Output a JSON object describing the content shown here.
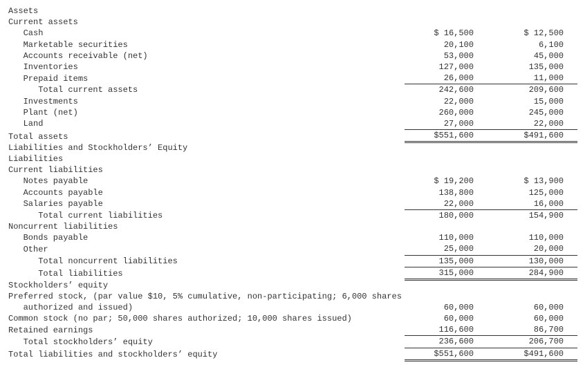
{
  "rows": [
    {
      "label": "Assets",
      "a": "",
      "b": "",
      "cls": ""
    },
    {
      "label": "Current assets",
      "a": "",
      "b": "",
      "cls": ""
    },
    {
      "label": "   Cash",
      "a": "$ 16,500",
      "b": "$ 12,500",
      "cls": ""
    },
    {
      "label": "   Marketable securities",
      "a": "20,100",
      "b": "6,100",
      "cls": ""
    },
    {
      "label": "   Accounts receivable (net)",
      "a": "53,000",
      "b": "45,000",
      "cls": ""
    },
    {
      "label": "   Inventories",
      "a": "127,000",
      "b": "135,000",
      "cls": ""
    },
    {
      "label": "   Prepaid items",
      "a": "26,000",
      "b": "11,000",
      "cls": "single"
    },
    {
      "label": "      Total current assets",
      "a": "242,600",
      "b": "209,600",
      "cls": ""
    },
    {
      "label": "   Investments",
      "a": "22,000",
      "b": "15,000",
      "cls": ""
    },
    {
      "label": "   Plant (net)",
      "a": "260,000",
      "b": "245,000",
      "cls": ""
    },
    {
      "label": "   Land",
      "a": "27,000",
      "b": "22,000",
      "cls": "single"
    },
    {
      "label": "Total assets",
      "a": "$551,600",
      "b": "$491,600",
      "cls": "dbl"
    },
    {
      "label": "Liabilities and Stockholders’ Equity",
      "a": "",
      "b": "",
      "cls": ""
    },
    {
      "label": "Liabilities",
      "a": "",
      "b": "",
      "cls": ""
    },
    {
      "label": "Current liabilities",
      "a": "",
      "b": "",
      "cls": ""
    },
    {
      "label": "   Notes payable",
      "a": "$ 19,200",
      "b": "$ 13,900",
      "cls": ""
    },
    {
      "label": "   Accounts payable",
      "a": "138,800",
      "b": "125,000",
      "cls": ""
    },
    {
      "label": "   Salaries payable",
      "a": "22,000",
      "b": "16,000",
      "cls": "single"
    },
    {
      "label": "      Total current liabilities",
      "a": "180,000",
      "b": "154,900",
      "cls": "subtotal"
    },
    {
      "label": "Noncurrent liabilities",
      "a": "",
      "b": "",
      "cls": ""
    },
    {
      "label": "   Bonds payable",
      "a": "110,000",
      "b": "110,000",
      "cls": ""
    },
    {
      "label": "   Other",
      "a": "25,000",
      "b": "20,000",
      "cls": "single"
    },
    {
      "label": "      Total noncurrent liabilities",
      "a": "135,000",
      "b": "130,000",
      "cls": "subtotal"
    },
    {
      "label": "      Total liabilities",
      "a": "315,000",
      "b": "284,900",
      "cls": "dbl"
    },
    {
      "label": "Stockholders’ equity",
      "a": "",
      "b": "",
      "cls": ""
    },
    {
      "label": "Preferred stock, (par value $10, 5% cumulative, non-participating; 6,000 shares\n   authorized and issued)",
      "a": "60,000",
      "b": "60,000",
      "cls": ""
    },
    {
      "label": "Common stock (no par; 50,000 shares authorized; 10,000 shares issued)",
      "a": "60,000",
      "b": "60,000",
      "cls": ""
    },
    {
      "label": "Retained earnings",
      "a": "116,600",
      "b": "86,700",
      "cls": "single"
    },
    {
      "label": "   Total stockholders’ equity",
      "a": "236,600",
      "b": "206,700",
      "cls": "subtotal"
    },
    {
      "label": "Total liabilities and stockholders’ equity",
      "a": "$551,600",
      "b": "$491,600",
      "cls": "dbl"
    }
  ]
}
